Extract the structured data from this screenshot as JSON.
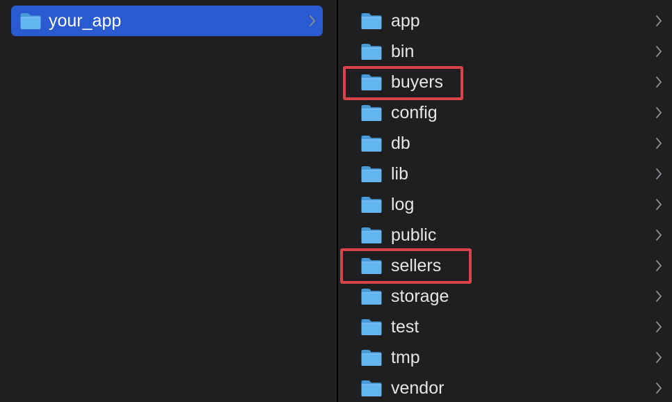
{
  "colors": {
    "background": "#1f1f21",
    "selection": "#2a5ad0",
    "folder": "#5fb3ee",
    "text": "#e6e6e6",
    "highlight_box": "#d9444a"
  },
  "left_column": {
    "items": [
      {
        "label": "your_app",
        "icon": "folder-icon",
        "selected": true
      }
    ]
  },
  "right_column": {
    "items": [
      {
        "label": "app",
        "icon": "folder-icon"
      },
      {
        "label": "bin",
        "icon": "folder-icon"
      },
      {
        "label": "buyers",
        "icon": "folder-icon",
        "highlighted": true
      },
      {
        "label": "config",
        "icon": "folder-icon"
      },
      {
        "label": "db",
        "icon": "folder-icon"
      },
      {
        "label": "lib",
        "icon": "folder-icon"
      },
      {
        "label": "log",
        "icon": "folder-icon"
      },
      {
        "label": "public",
        "icon": "folder-icon"
      },
      {
        "label": "sellers",
        "icon": "folder-icon",
        "highlighted": true
      },
      {
        "label": "storage",
        "icon": "folder-icon"
      },
      {
        "label": "test",
        "icon": "folder-icon"
      },
      {
        "label": "tmp",
        "icon": "folder-icon"
      },
      {
        "label": "vendor",
        "icon": "folder-icon"
      }
    ]
  }
}
